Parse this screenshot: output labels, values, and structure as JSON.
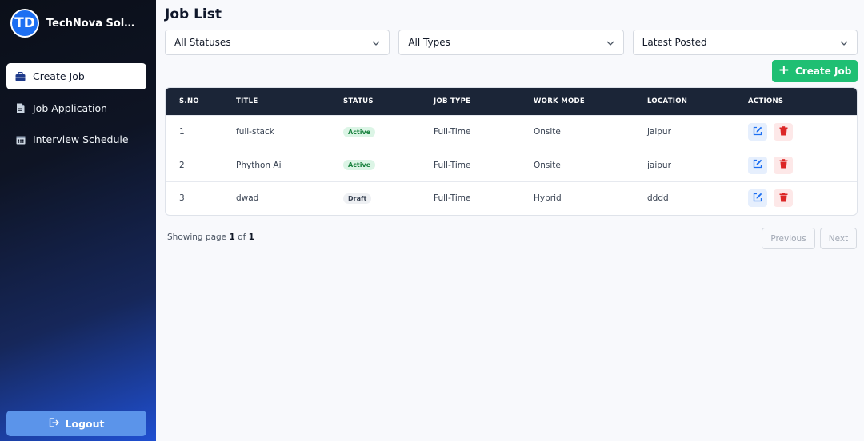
{
  "brand": {
    "logo_text": "TD",
    "name": "TechNova Solutions"
  },
  "sidebar": {
    "items": [
      {
        "label": "Create Job",
        "icon": "briefcase-icon",
        "active": true
      },
      {
        "label": "Job Application",
        "icon": "document-icon",
        "active": false
      },
      {
        "label": "Interview Schedule",
        "icon": "calendar-icon",
        "active": false
      }
    ],
    "logout_label": "Logout"
  },
  "page": {
    "title": "Job List"
  },
  "filters": {
    "status": "All Statuses",
    "type": "All Types",
    "sort": "Latest Posted"
  },
  "toolbar": {
    "create_label": "Create Job"
  },
  "table": {
    "headers": [
      "S.NO",
      "TITLE",
      "STATUS",
      "JOB TYPE",
      "WORK MODE",
      "LOCATION",
      "ACTIONS"
    ],
    "rows": [
      {
        "sno": "1",
        "title": "full-stack",
        "status": "Active",
        "job_type": "Full-Time",
        "work_mode": "Onsite",
        "location": "jaipur"
      },
      {
        "sno": "2",
        "title": "Phython Ai",
        "status": "Active",
        "job_type": "Full-Time",
        "work_mode": "Onsite",
        "location": "jaipur"
      },
      {
        "sno": "3",
        "title": "dwad",
        "status": "Draft",
        "job_type": "Full-Time",
        "work_mode": "Hybrid",
        "location": "dddd"
      }
    ]
  },
  "pagination": {
    "prefix": "Showing page",
    "current": "1",
    "of": "of",
    "total": "1",
    "prev_label": "Previous",
    "next_label": "Next"
  },
  "colors": {
    "accent_green": "#1fbf73",
    "table_header": "#1b2537",
    "edit_blue": "#1d6ff2",
    "delete_red": "#dc2626"
  }
}
